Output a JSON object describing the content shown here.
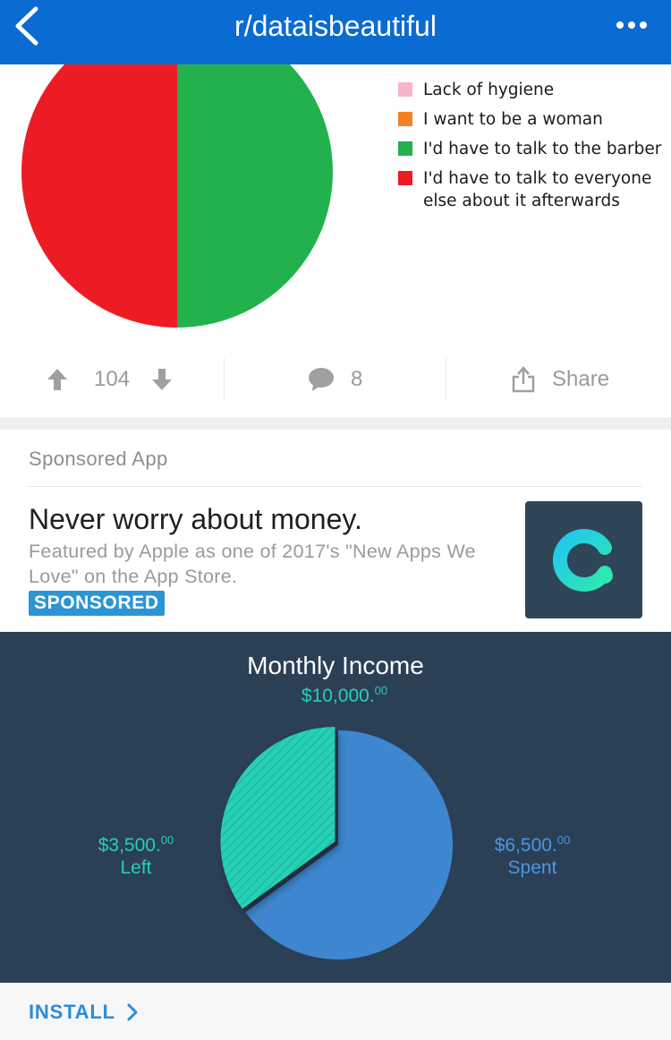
{
  "header": {
    "title": "r/dataisbeautiful",
    "back_icon": "chevron-left-icon",
    "more_icon": "more-horizontal-icon",
    "color": "#0a6bd2"
  },
  "post_chart": {
    "chart_data": {
      "type": "pie",
      "categories": [
        "Lack of hygiene",
        "I want to be a woman",
        "I'd have to talk to the barber",
        "I'd have to talk to everyone else about it afterwards"
      ],
      "values": [
        0,
        0,
        50,
        50
      ],
      "colors": [
        "#f9b3cc",
        "#f5821f",
        "#22b14c",
        "#ed1c24"
      ],
      "legend": "right"
    },
    "legend": [
      {
        "line1": "Lack of hygiene",
        "line2": "",
        "color": "#f9b3cc"
      },
      {
        "line1": "I want to be a woman",
        "line2": "",
        "color": "#f5821f"
      },
      {
        "line1": "I'd have to talk to the barber",
        "line2": "",
        "color": "#22b14c"
      },
      {
        "line1": "I'd have to talk to everyone",
        "line2": "else about it afterwards",
        "color": "#ed1c24"
      }
    ]
  },
  "actions": {
    "upvote_icon": "arrow-up-icon",
    "score": "104",
    "downvote_icon": "arrow-down-icon",
    "comment_icon": "comment-bubble-icon",
    "comments": "8",
    "share_icon": "share-icon",
    "share_label": "Share"
  },
  "sponsored": {
    "label": "Sponsored App",
    "title": "Never worry about money.",
    "description": "Featured by Apple as one of 2017's \"New Apps We Love\" on the App Store.",
    "badge": "SPONSORED",
    "app_icon": "clarity-logo-icon",
    "accent": "#2b95d6"
  },
  "creative": {
    "title": "Monthly Income",
    "total": "$10,000.",
    "total_cents": "00",
    "left": {
      "amount": "$3,500.",
      "cents": "00",
      "label": "Left"
    },
    "spent": {
      "amount": "$6,500.",
      "cents": "00",
      "label": "Spent"
    },
    "chart_data": {
      "type": "pie",
      "categories": [
        "Left",
        "Spent"
      ],
      "values": [
        3500,
        6500
      ],
      "colors": [
        "#25d0b6",
        "#3e87d0"
      ]
    }
  },
  "install": {
    "label": "INSTALL",
    "icon": "chevron-right-icon"
  }
}
